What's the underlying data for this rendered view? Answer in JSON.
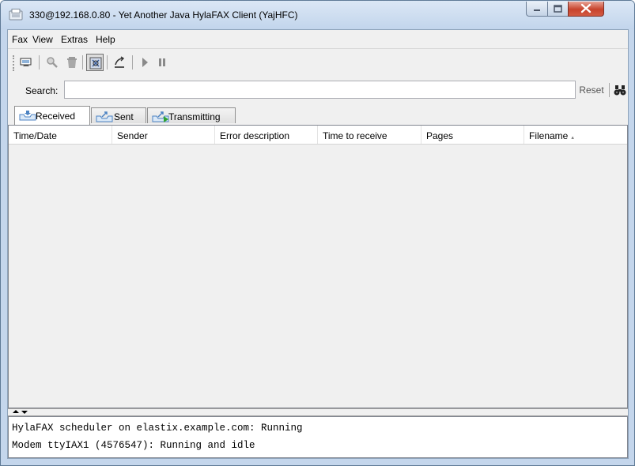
{
  "window": {
    "title": "330@192.168.0.80 - Yet Another Java HylaFAX Client (YajHFC)"
  },
  "menubar": {
    "items": [
      "Fax",
      "View",
      "Extras",
      "Help"
    ]
  },
  "toolbar": {
    "buttons": [
      "view-fax-icon",
      "search-fax-icon",
      "delete-icon",
      "refresh-icon",
      "answer-call-icon",
      "resume-icon",
      "suspend-icon"
    ]
  },
  "search": {
    "label": "Search:",
    "value": "",
    "reset_label": "Reset",
    "find_icon": "binoculars-icon"
  },
  "tabs": [
    {
      "label": "Received",
      "icon": "inbox-tray-icon",
      "active": true
    },
    {
      "label": "Sent",
      "icon": "outbox-tray-icon",
      "active": false
    },
    {
      "label": "Transmitting",
      "icon": "transmitting-tray-icon",
      "active": false
    }
  ],
  "table": {
    "columns": [
      "Time/Date",
      "Sender",
      "Error description",
      "Time to receive",
      "Pages",
      "Filename"
    ],
    "sorted_column": "Filename",
    "rows": []
  },
  "status": {
    "lines": [
      "HylaFAX scheduler on elastix.example.com: Running",
      "Modem ttyIAX1 (4576547): Running and idle"
    ]
  },
  "colors": {
    "title_bar": "#c2d5ec",
    "close_button": "#c7432c",
    "window_background": "#f0f0f0"
  }
}
